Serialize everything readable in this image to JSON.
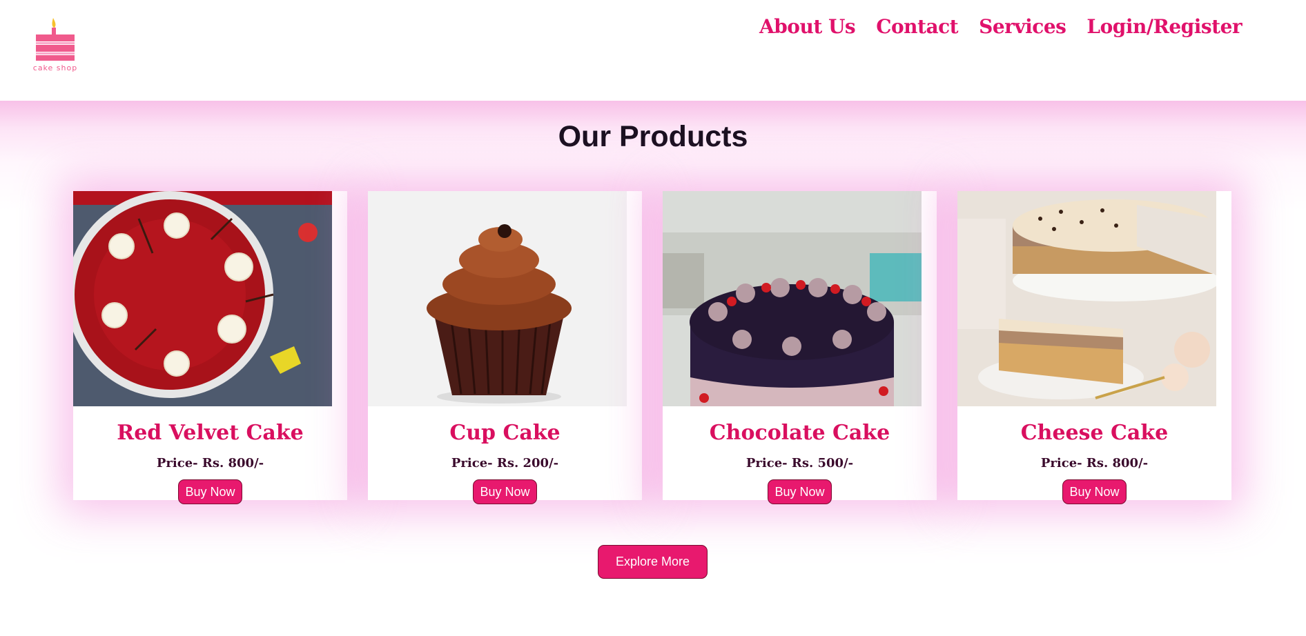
{
  "header": {
    "logo_text": "cake shop",
    "nav": [
      {
        "label": "About Us"
      },
      {
        "label": "Contact"
      },
      {
        "label": "Services"
      },
      {
        "label": "Login/Register"
      }
    ]
  },
  "main": {
    "title": "Our Products",
    "products": [
      {
        "name": "Red Velvet Cake",
        "price": "Price- Rs. 800/-",
        "button": "Buy Now",
        "image": "red-velvet-cake-photo"
      },
      {
        "name": "Cup Cake",
        "price": "Price- Rs. 200/-",
        "button": "Buy Now",
        "image": "chocolate-cupcake-photo"
      },
      {
        "name": "Chocolate Cake",
        "price": "Price- Rs. 500/-",
        "button": "Buy Now",
        "image": "chocolate-cake-photo"
      },
      {
        "name": "Cheese Cake",
        "price": "Price- Rs. 800/-",
        "button": "Buy Now",
        "image": "cheese-cake-photo"
      }
    ],
    "explore_label": "Explore More"
  },
  "colors": {
    "accent": "#e8196e",
    "nav_text": "#e0116b",
    "product_name": "#d90f5f",
    "price_text": "#3a0a2c",
    "glow": "#f8c1e8"
  }
}
